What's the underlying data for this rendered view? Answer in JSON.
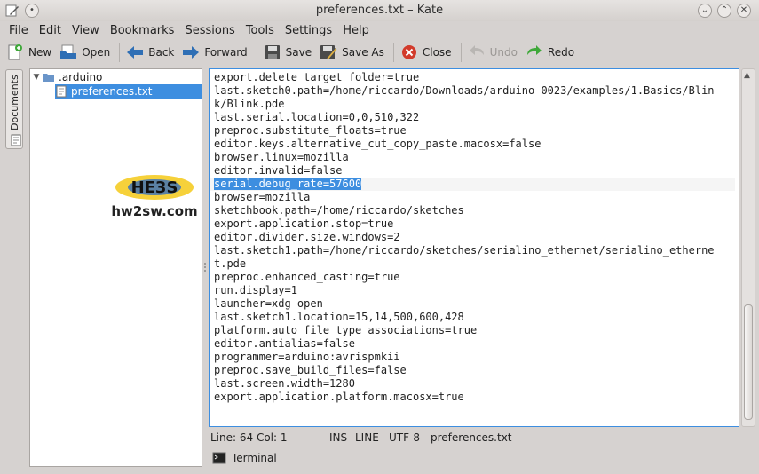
{
  "window": {
    "title": "preferences.txt – Kate"
  },
  "menu": [
    "File",
    "Edit",
    "View",
    "Bookmarks",
    "Sessions",
    "Tools",
    "Settings",
    "Help"
  ],
  "toolbar": {
    "new": "New",
    "open": "Open",
    "back": "Back",
    "forward": "Forward",
    "save": "Save",
    "save_as": "Save As",
    "close": "Close",
    "undo": "Undo",
    "redo": "Redo"
  },
  "sidebar": {
    "documents_tab": "Documents"
  },
  "tree": {
    "folder": ".arduino",
    "file": "preferences.txt"
  },
  "logo": {
    "text": "hw2sw.com",
    "mark": "HE3S"
  },
  "editor": {
    "lines": [
      "export.delete_target_folder=true",
      "last.sketch0.path=/home/riccardo/Downloads/arduino-0023/examples/1.Basics/Blin",
      "k/Blink.pde",
      "last.serial.location=0,0,510,322",
      "preproc.substitute_floats=true",
      "editor.keys.alternative_cut_copy_paste.macosx=false",
      "browser.linux=mozilla",
      "editor.invalid=false",
      "serial.debug_rate=57600",
      "browser=mozilla",
      "sketchbook.path=/home/riccardo/sketches",
      "export.application.stop=true",
      "editor.divider.size.windows=2",
      "last.sketch1.path=/home/riccardo/sketches/serialino_ethernet/serialino_etherne",
      "t.pde",
      "preproc.enhanced_casting=true",
      "run.display=1",
      "launcher=xdg-open",
      "last.sketch1.location=15,14,500,600,428",
      "platform.auto_file_type_associations=true",
      "editor.antialias=false",
      "programmer=arduino:avrispmkii",
      "preproc.save_build_files=false",
      "last.screen.width=1280",
      "export.application.platform.macosx=true"
    ],
    "selected_line_index": 8
  },
  "status": {
    "position": "Line: 64 Col: 1",
    "ins": "INS",
    "mode": "LINE",
    "encoding": "UTF-8",
    "filename": "preferences.txt"
  },
  "bottom_tools": {
    "terminal": "Terminal"
  },
  "colors": {
    "accent": "#3d8ee0",
    "window_bg": "#d6d2d0"
  }
}
